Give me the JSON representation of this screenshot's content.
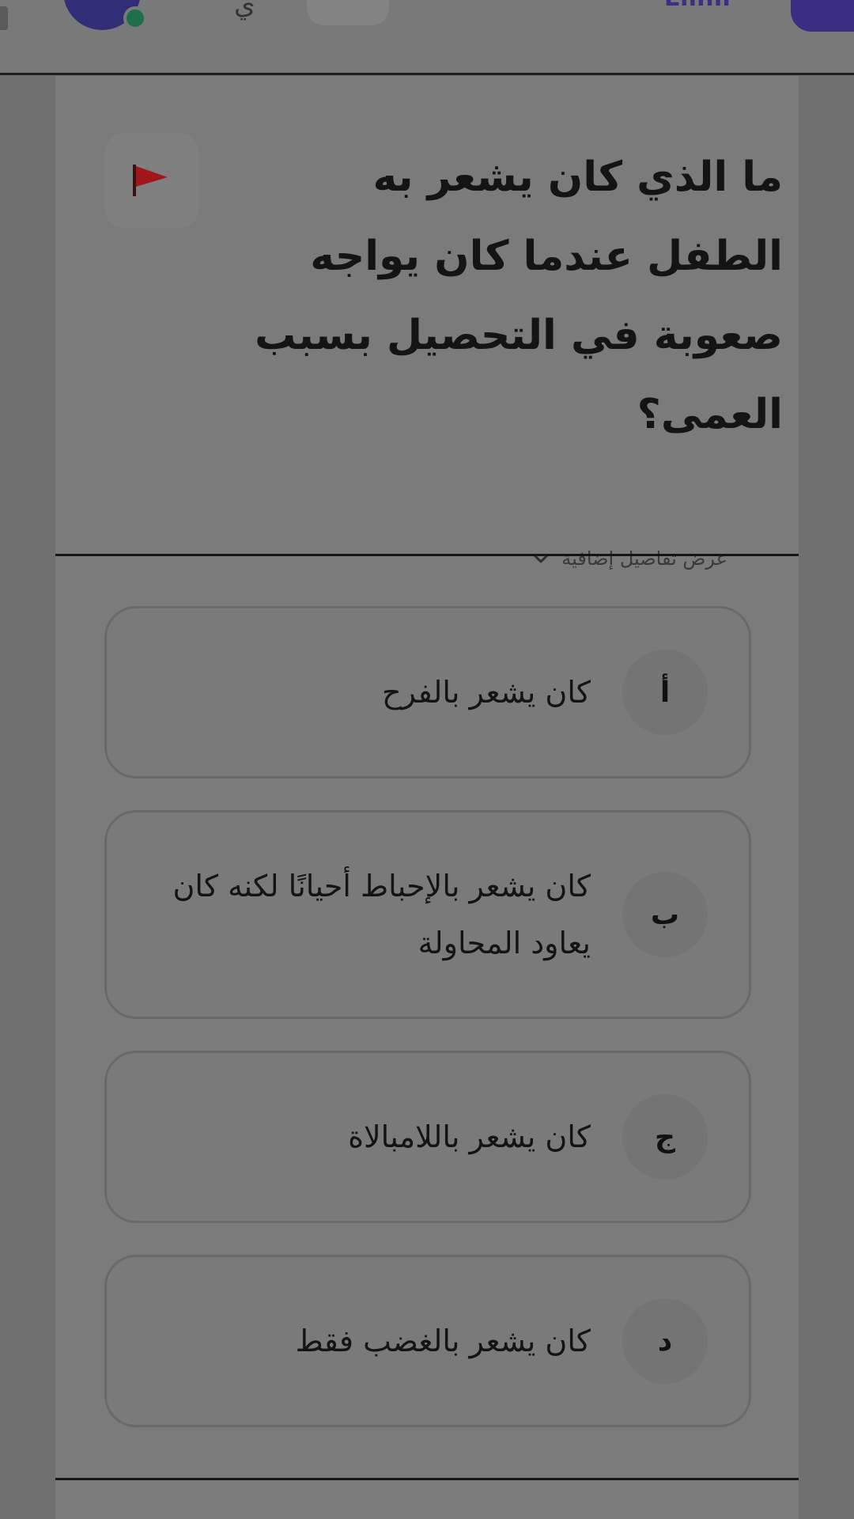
{
  "header": {
    "brand_text": "Lmm",
    "center_glyph": "ي"
  },
  "question": {
    "text": "ما الذي كان يشعر به الطفل عندما كان يواجه صعوبة في التحصيل بسبب العمى؟",
    "details_label": "عرض تفاصيل إضافية"
  },
  "options": [
    {
      "letter": "أ",
      "text": "كان يشعر بالفرح"
    },
    {
      "letter": "ب",
      "text": "كان يشعر بالإحباط أحيانًا لكنه كان يعاود المحاولة"
    },
    {
      "letter": "ج",
      "text": "كان يشعر باللامبالاة"
    },
    {
      "letter": "د",
      "text": "كان يشعر بالغضب فقط"
    }
  ],
  "icons": {
    "flag": "flag-icon",
    "chevron": "chevron-down-icon"
  },
  "colors": {
    "brand": "#3b2e82",
    "flag": "#a0161a",
    "status_dot": "#1f6f4a"
  }
}
